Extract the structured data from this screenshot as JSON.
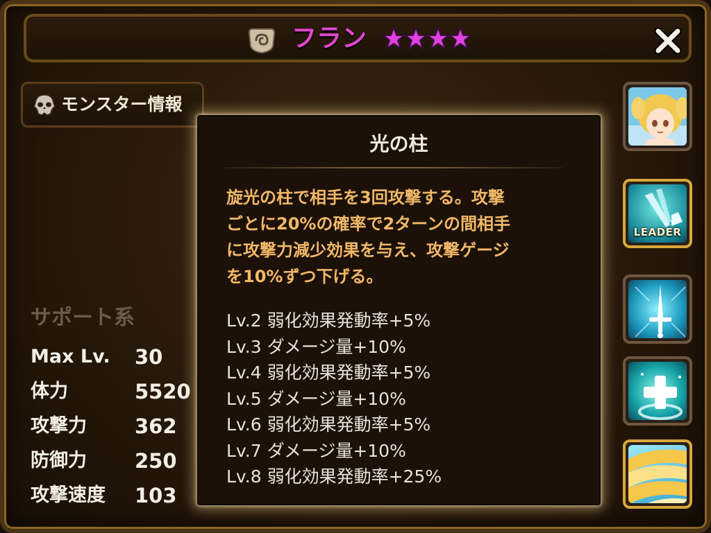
{
  "header": {
    "monster_name": "フラン",
    "star_count": 4,
    "element_icon": "light-element-icon",
    "close_icon": "close-x-icon"
  },
  "info_tab": {
    "label": "モンスター情報",
    "icon": "skull-icon"
  },
  "skill": {
    "title": "光の柱",
    "description_lines": [
      "旋光の柱で相手を3回攻撃する。攻撃",
      "ごとに20%の確率で2ターンの間相手",
      "に攻撃力減少効果を与え、攻撃ゲージ",
      "を10%ずつ下げる。"
    ],
    "levels": [
      "Lv.2 弱化効果発動率+5%",
      "Lv.3 ダメージ量+10%",
      "Lv.4 弱化効果発動率+5%",
      "Lv.5 ダメージ量+10%",
      "Lv.6 弱化効果発動率+5%",
      "Lv.7 ダメージ量+10%",
      "Lv.8 弱化効果発動率+25%"
    ]
  },
  "stats": {
    "category": "サポート系",
    "rows": [
      {
        "label": "Max Lv.",
        "value": "30"
      },
      {
        "label": "体力",
        "value": "5520"
      },
      {
        "label": "攻撃力",
        "value": "362"
      },
      {
        "label": "防御力",
        "value": "250"
      },
      {
        "label": "攻撃速度",
        "value": "103"
      }
    ]
  },
  "side_buttons": [
    {
      "name": "monster-portrait-button",
      "icon": "fairy-portrait-icon"
    },
    {
      "name": "leader-skill-button",
      "icon": "sword-leader-icon",
      "label": "LEADER"
    },
    {
      "name": "skill-1-button",
      "icon": "light-sword-icon"
    },
    {
      "name": "skill-2-button",
      "icon": "heal-cross-icon"
    },
    {
      "name": "skill-3-button",
      "icon": "light-pillar-icon"
    }
  ],
  "colors": {
    "name": "#e046d0",
    "star": "#e040e0",
    "description": "#f1b868",
    "category": "#6a5c48",
    "active_border": "#d9a83a"
  }
}
